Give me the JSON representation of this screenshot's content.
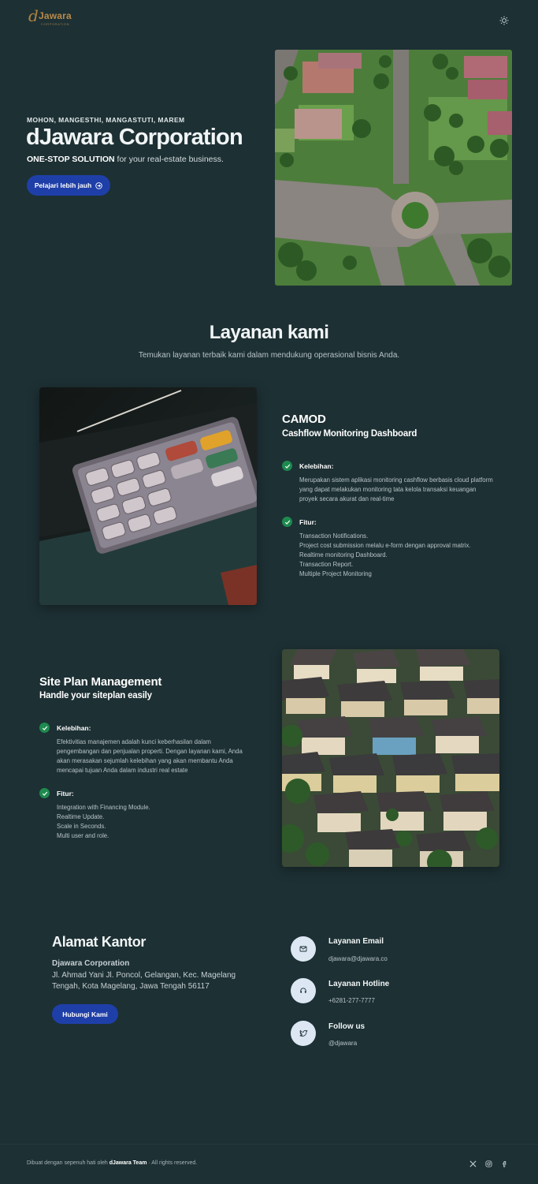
{
  "brand": {
    "mark": "d",
    "name": "Jawara",
    "sub": "CORPORATION"
  },
  "hero": {
    "eyebrow": "MOHON, MANGESTHI, MANGASTUTI, MAREM",
    "title": "dJawara Corporation",
    "tagline_bold": "ONE-STOP SOLUTION",
    "tagline_rest": " for your real-estate business.",
    "cta": "Pelajari lebih jauh"
  },
  "services": {
    "title": "Layanan kami",
    "subtitle": "Temukan layanan terbaik kami dalam mendukung operasional bisnis Anda."
  },
  "products": [
    {
      "name": "CAMOD",
      "desc": "Cashflow Monitoring Dashboard",
      "adv_label": "Kelebihan:",
      "adv_text": "Merupakan sistem aplikasi monitoring cashflow berbasis cloud platform yang dapat melakukan monitoring tata kelola transaksi keuangan proyek secara akurat dan real-time",
      "feat_label": "Fitur:",
      "features": [
        "Transaction Notifications.",
        "Project cost submission melalu e-form dengan approval matrix.",
        "Realtime monitoring Dashboard.",
        "Transaction Report.",
        "Multiple Project Monitoring"
      ]
    },
    {
      "name": "Site Plan Management",
      "desc": "Handle your siteplan easily",
      "adv_label": "Kelebihan:",
      "adv_text": "Efektivitias manajemen adalah kunci keberhasilan dalam pengembangan dan penjualan properti. Dengan layanan kami, Anda akan merasakan sejumlah kelebihan yang akan membantu Anda mencapai tujuan Anda dalam industri real estate",
      "feat_label": "Fitur:",
      "features": [
        "Integration with Financing Module.",
        "Realtime Update.",
        "Scale in Seconds.",
        "Multi user and role."
      ]
    }
  ],
  "office": {
    "title": "Alamat Kantor",
    "company": "Djawara Corporation",
    "address": "Jl. Ahmad Yani Jl. Poncol, Gelangan, Kec. Magelang Tengah, Kota Magelang, Jawa Tengah 56117",
    "cta": "Hubungi Kami"
  },
  "contacts": [
    {
      "label": "Layanan Email",
      "value": "djawara@djawara.co",
      "icon": "mail-icon"
    },
    {
      "label": "Layanan Hotline",
      "value": "+6281-277-7777",
      "icon": "headset-icon"
    },
    {
      "label": "Follow us",
      "value": "@djawara",
      "icon": "twitter-icon"
    }
  ],
  "footer": {
    "prefix": "Dibuat dengan sepenuh hati oleh ",
    "team": "dJawara Team",
    "suffix": " · All rights reserved."
  },
  "colors": {
    "background": "#1d3034",
    "primary": "#1f3fa8",
    "check": "#1e8a4f",
    "brand": "#b0823f"
  }
}
